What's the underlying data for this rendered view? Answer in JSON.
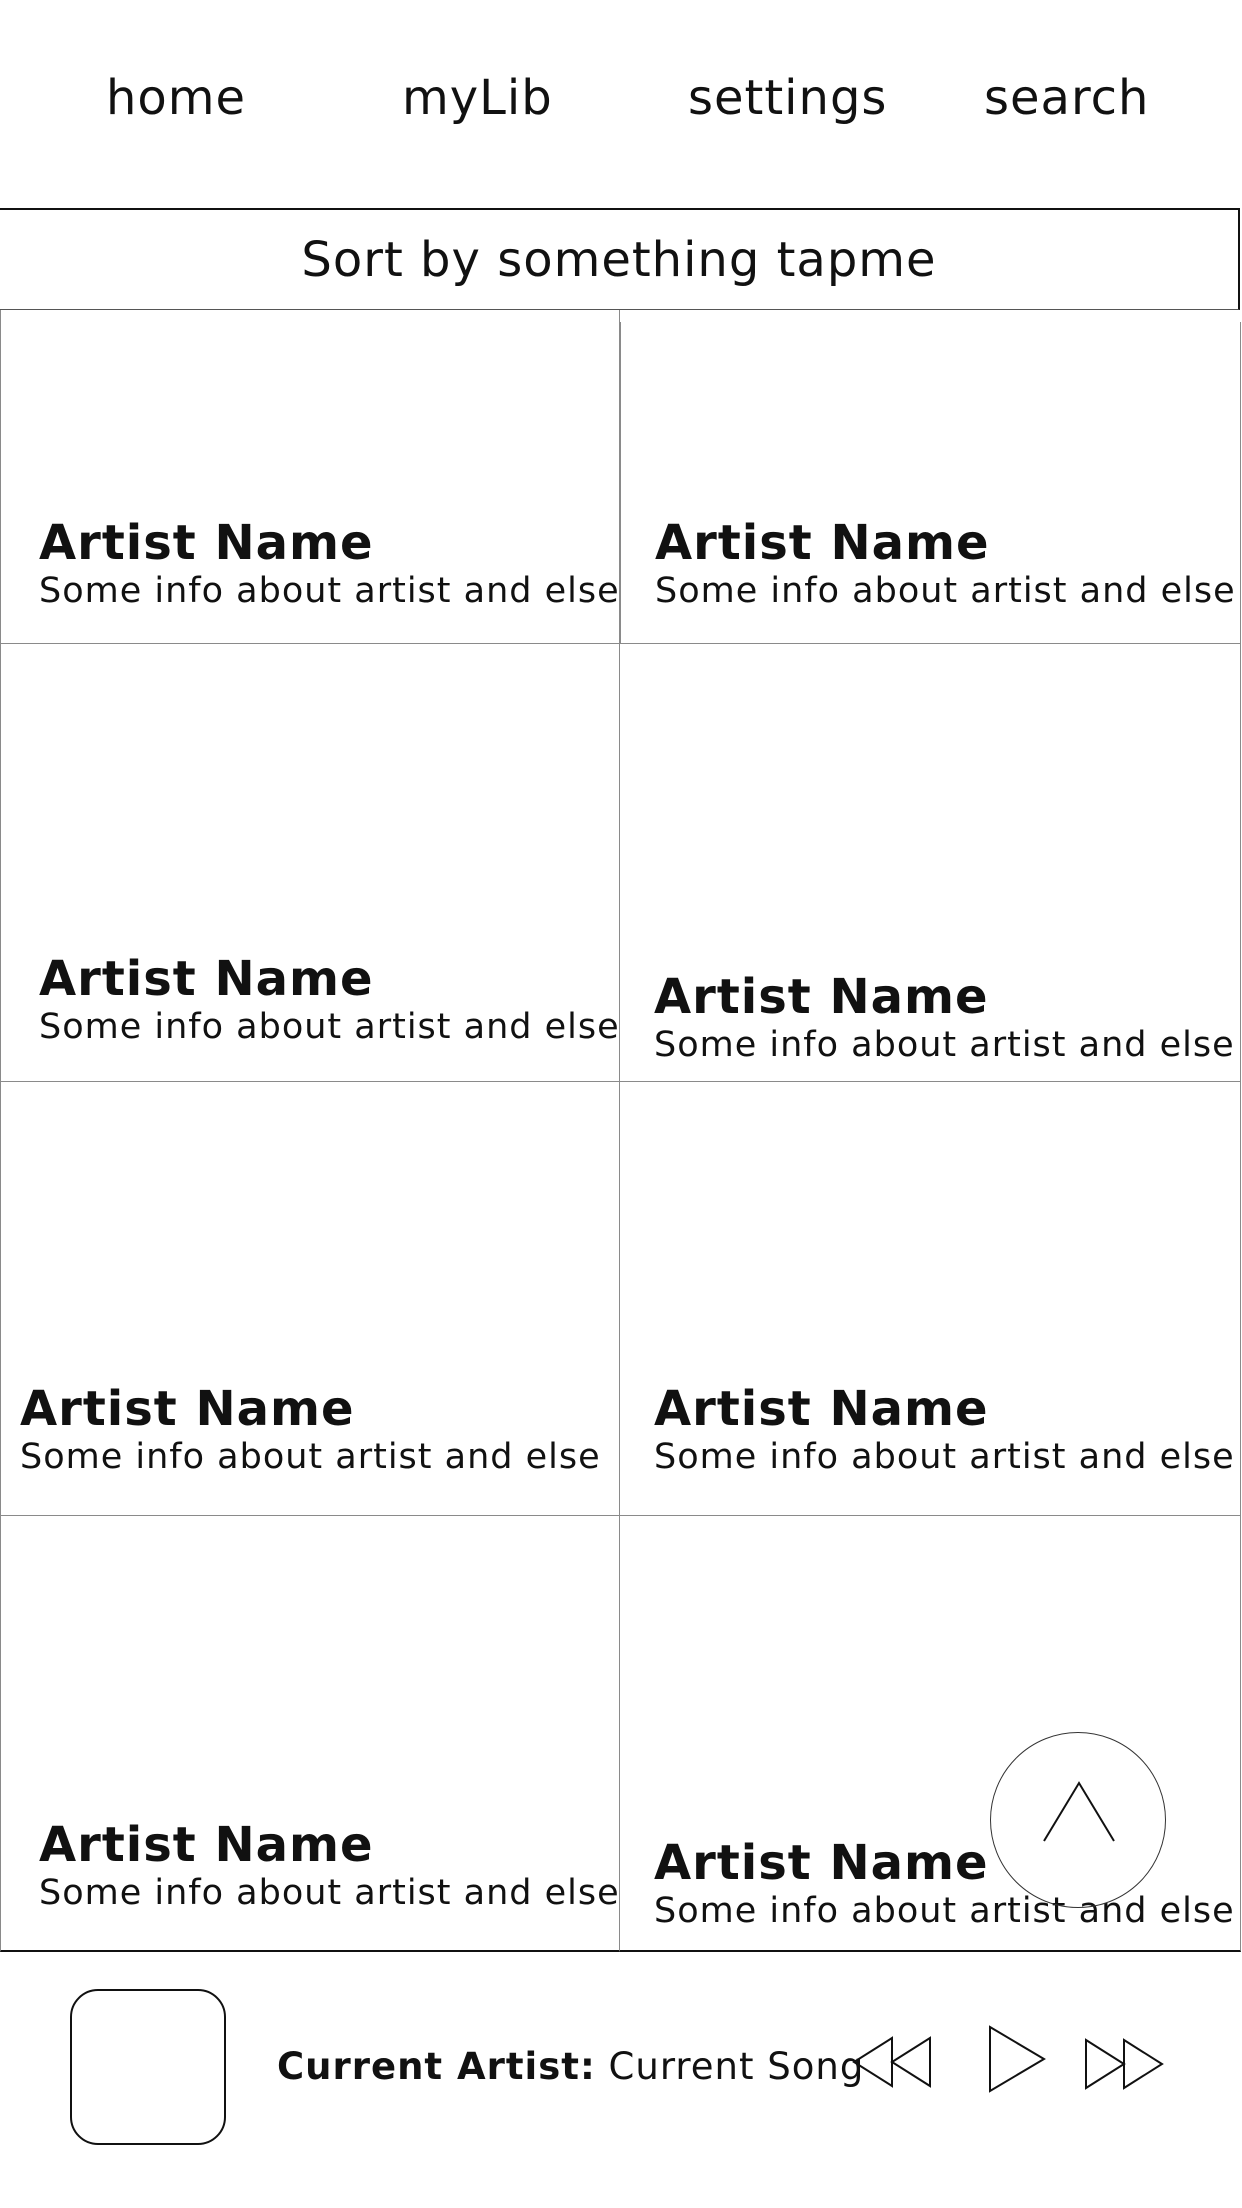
{
  "nav": {
    "home": "home",
    "mylib": "myLib",
    "settings": "settings",
    "search": "search"
  },
  "sort": {
    "label": "Sort by something tapme"
  },
  "artists": [
    {
      "name": "Artist Name",
      "info": "Some info about artist and else"
    },
    {
      "name": "Artist Name",
      "info": "Some info about artist and else"
    },
    {
      "name": "Artist Name",
      "info": "Some info about artist and else"
    },
    {
      "name": "Artist Name",
      "info": "Some info about artist and else"
    },
    {
      "name": "Artist Name",
      "info": "Some info about artist and else"
    },
    {
      "name": "Artist Name",
      "info": "Some info about artist and else"
    },
    {
      "name": "Artist Name",
      "info": "Some info about artist and else"
    },
    {
      "name": "Artist Name",
      "info": "Some info about artist and else"
    }
  ],
  "player": {
    "artist_label": "Current Artist:",
    "song": "Current Song"
  },
  "icons": {
    "scroll_top": "chevron-up-icon",
    "rewind": "rewind-icon",
    "play": "play-icon",
    "fast_forward": "fast-forward-icon"
  }
}
